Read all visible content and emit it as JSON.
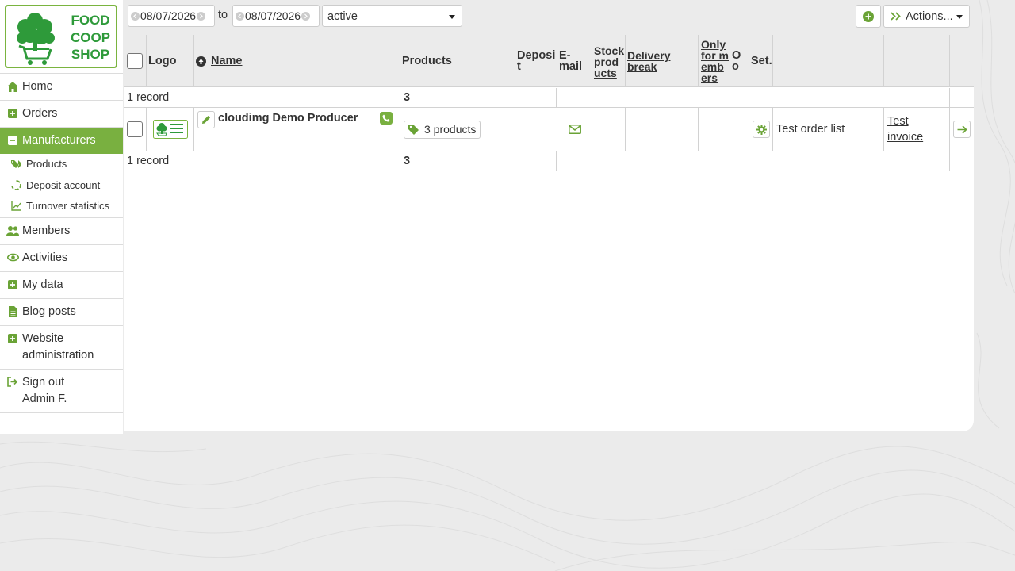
{
  "sidebar": {
    "logo_lines": [
      "FOOD",
      "COOP",
      "SHOP"
    ],
    "items": [
      {
        "label": "Home",
        "icon": "home-icon"
      },
      {
        "label": "Orders",
        "icon": "plus-square-icon"
      },
      {
        "label": "Manufacturers",
        "icon": "minus-square-icon",
        "active": true
      },
      {
        "label": "Members",
        "icon": "users-icon"
      },
      {
        "label": "Activities",
        "icon": "eye-icon"
      },
      {
        "label": "My data",
        "icon": "plus-square-icon"
      },
      {
        "label": "Blog posts",
        "icon": "file-icon"
      },
      {
        "label": "Website administration",
        "icon": "plus-square-icon"
      },
      {
        "label": "Sign out",
        "sub": "Admin F.",
        "icon": "sign-out-icon"
      }
    ],
    "subitems": [
      {
        "label": "Products",
        "icon": "tags-icon"
      },
      {
        "label": "Deposit account",
        "icon": "recycle-icon"
      },
      {
        "label": "Turnover statistics",
        "icon": "line-chart-icon"
      }
    ]
  },
  "filter": {
    "date_from": "08/07/2026",
    "to_label": "to",
    "date_to": "08/07/2026",
    "status": "active",
    "actions_label": "Actions..."
  },
  "table": {
    "headers": {
      "logo": "Logo",
      "name": "Name",
      "products": "Products",
      "deposit": "Deposit",
      "email": "E-mail",
      "stock_products": "Stock products",
      "delivery_break": "Delivery break",
      "only_for_members": "Only for members",
      "o": "O o",
      "set": "Set."
    },
    "summary": {
      "records": "1 record",
      "products": "3"
    },
    "rows": [
      {
        "name": "cloudimg Demo Producer",
        "products": "3 products",
        "order_list": "Test order list",
        "invoice": "Test invoice"
      }
    ]
  },
  "colors": {
    "accent": "#79b040",
    "logo_green": "#2e9a3a",
    "icon_green": "#6aa336"
  }
}
